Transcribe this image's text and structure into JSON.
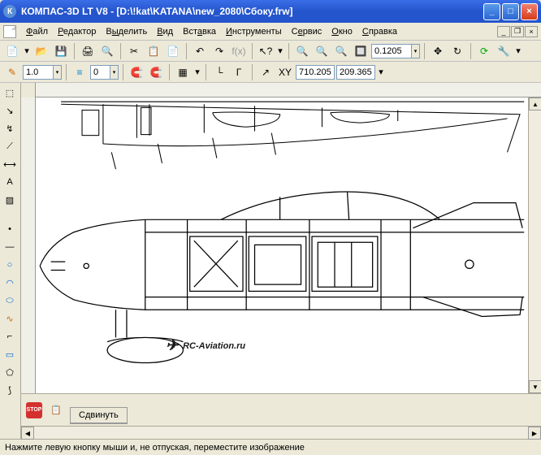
{
  "titlebar": {
    "title": "КОМПАС-3D LT V8 - [D:\\!kat\\KATANA\\new_2080\\Сбоку.frw]"
  },
  "menu": {
    "file": "Файл",
    "editor": "Редактор",
    "select": "Выделить",
    "view": "Вид",
    "insert": "Вставка",
    "tools": "Инструменты",
    "service": "Сервис",
    "window": "Окно",
    "help": "Справка"
  },
  "toolbar1": {
    "zoom_value": "0.1205"
  },
  "toolbar2": {
    "style_value": "1.0",
    "layer_value": "0",
    "coord_x": "710.205",
    "coord_y": "209.365"
  },
  "watermark": {
    "text": "RC-Aviation.ru",
    "icon": "✈"
  },
  "bottom": {
    "stop_label": "STOP",
    "tab_label": "Сдвинуть"
  },
  "statusbar": {
    "text": "Нажмите левую кнопку мыши и, не отпуская, переместите изображение"
  }
}
